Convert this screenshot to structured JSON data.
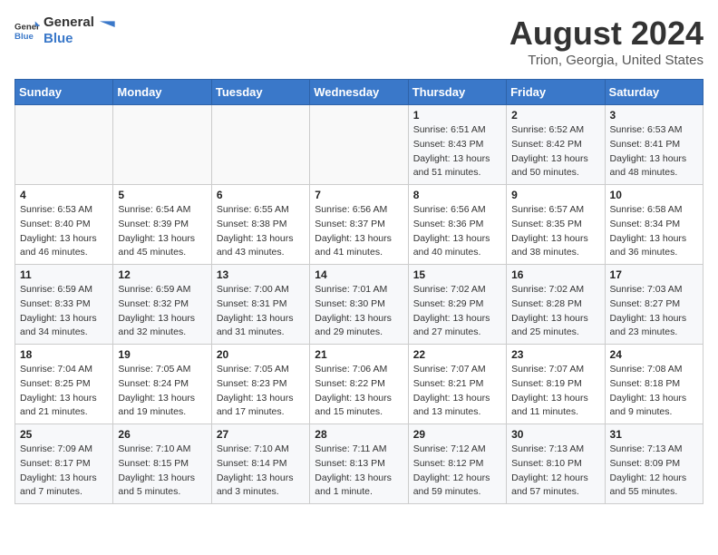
{
  "logo": {
    "text_general": "General",
    "text_blue": "Blue"
  },
  "title": "August 2024",
  "subtitle": "Trion, Georgia, United States",
  "headers": [
    "Sunday",
    "Monday",
    "Tuesday",
    "Wednesday",
    "Thursday",
    "Friday",
    "Saturday"
  ],
  "weeks": [
    [
      {
        "day": "",
        "info": ""
      },
      {
        "day": "",
        "info": ""
      },
      {
        "day": "",
        "info": ""
      },
      {
        "day": "",
        "info": ""
      },
      {
        "day": "1",
        "info": "Sunrise: 6:51 AM\nSunset: 8:43 PM\nDaylight: 13 hours\nand 51 minutes."
      },
      {
        "day": "2",
        "info": "Sunrise: 6:52 AM\nSunset: 8:42 PM\nDaylight: 13 hours\nand 50 minutes."
      },
      {
        "day": "3",
        "info": "Sunrise: 6:53 AM\nSunset: 8:41 PM\nDaylight: 13 hours\nand 48 minutes."
      }
    ],
    [
      {
        "day": "4",
        "info": "Sunrise: 6:53 AM\nSunset: 8:40 PM\nDaylight: 13 hours\nand 46 minutes."
      },
      {
        "day": "5",
        "info": "Sunrise: 6:54 AM\nSunset: 8:39 PM\nDaylight: 13 hours\nand 45 minutes."
      },
      {
        "day": "6",
        "info": "Sunrise: 6:55 AM\nSunset: 8:38 PM\nDaylight: 13 hours\nand 43 minutes."
      },
      {
        "day": "7",
        "info": "Sunrise: 6:56 AM\nSunset: 8:37 PM\nDaylight: 13 hours\nand 41 minutes."
      },
      {
        "day": "8",
        "info": "Sunrise: 6:56 AM\nSunset: 8:36 PM\nDaylight: 13 hours\nand 40 minutes."
      },
      {
        "day": "9",
        "info": "Sunrise: 6:57 AM\nSunset: 8:35 PM\nDaylight: 13 hours\nand 38 minutes."
      },
      {
        "day": "10",
        "info": "Sunrise: 6:58 AM\nSunset: 8:34 PM\nDaylight: 13 hours\nand 36 minutes."
      }
    ],
    [
      {
        "day": "11",
        "info": "Sunrise: 6:59 AM\nSunset: 8:33 PM\nDaylight: 13 hours\nand 34 minutes."
      },
      {
        "day": "12",
        "info": "Sunrise: 6:59 AM\nSunset: 8:32 PM\nDaylight: 13 hours\nand 32 minutes."
      },
      {
        "day": "13",
        "info": "Sunrise: 7:00 AM\nSunset: 8:31 PM\nDaylight: 13 hours\nand 31 minutes."
      },
      {
        "day": "14",
        "info": "Sunrise: 7:01 AM\nSunset: 8:30 PM\nDaylight: 13 hours\nand 29 minutes."
      },
      {
        "day": "15",
        "info": "Sunrise: 7:02 AM\nSunset: 8:29 PM\nDaylight: 13 hours\nand 27 minutes."
      },
      {
        "day": "16",
        "info": "Sunrise: 7:02 AM\nSunset: 8:28 PM\nDaylight: 13 hours\nand 25 minutes."
      },
      {
        "day": "17",
        "info": "Sunrise: 7:03 AM\nSunset: 8:27 PM\nDaylight: 13 hours\nand 23 minutes."
      }
    ],
    [
      {
        "day": "18",
        "info": "Sunrise: 7:04 AM\nSunset: 8:25 PM\nDaylight: 13 hours\nand 21 minutes."
      },
      {
        "day": "19",
        "info": "Sunrise: 7:05 AM\nSunset: 8:24 PM\nDaylight: 13 hours\nand 19 minutes."
      },
      {
        "day": "20",
        "info": "Sunrise: 7:05 AM\nSunset: 8:23 PM\nDaylight: 13 hours\nand 17 minutes."
      },
      {
        "day": "21",
        "info": "Sunrise: 7:06 AM\nSunset: 8:22 PM\nDaylight: 13 hours\nand 15 minutes."
      },
      {
        "day": "22",
        "info": "Sunrise: 7:07 AM\nSunset: 8:21 PM\nDaylight: 13 hours\nand 13 minutes."
      },
      {
        "day": "23",
        "info": "Sunrise: 7:07 AM\nSunset: 8:19 PM\nDaylight: 13 hours\nand 11 minutes."
      },
      {
        "day": "24",
        "info": "Sunrise: 7:08 AM\nSunset: 8:18 PM\nDaylight: 13 hours\nand 9 minutes."
      }
    ],
    [
      {
        "day": "25",
        "info": "Sunrise: 7:09 AM\nSunset: 8:17 PM\nDaylight: 13 hours\nand 7 minutes."
      },
      {
        "day": "26",
        "info": "Sunrise: 7:10 AM\nSunset: 8:15 PM\nDaylight: 13 hours\nand 5 minutes."
      },
      {
        "day": "27",
        "info": "Sunrise: 7:10 AM\nSunset: 8:14 PM\nDaylight: 13 hours\nand 3 minutes."
      },
      {
        "day": "28",
        "info": "Sunrise: 7:11 AM\nSunset: 8:13 PM\nDaylight: 13 hours\nand 1 minute."
      },
      {
        "day": "29",
        "info": "Sunrise: 7:12 AM\nSunset: 8:12 PM\nDaylight: 12 hours\nand 59 minutes."
      },
      {
        "day": "30",
        "info": "Sunrise: 7:13 AM\nSunset: 8:10 PM\nDaylight: 12 hours\nand 57 minutes."
      },
      {
        "day": "31",
        "info": "Sunrise: 7:13 AM\nSunset: 8:09 PM\nDaylight: 12 hours\nand 55 minutes."
      }
    ]
  ]
}
